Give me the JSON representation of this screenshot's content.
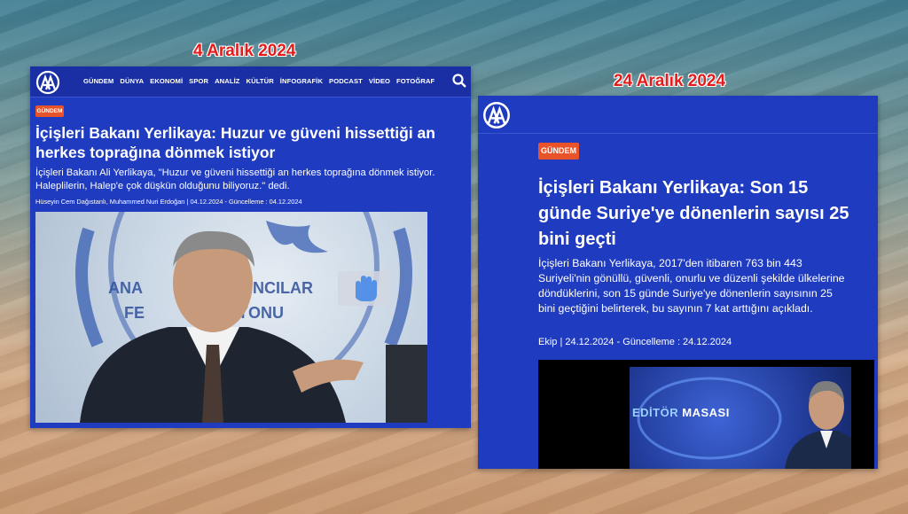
{
  "captions": {
    "left_date": "4 Aralık 2024",
    "right_date": "24 Aralık 2024"
  },
  "left_article": {
    "logo_text": "AA",
    "nav": [
      "GÜNDEM",
      "DÜNYA",
      "EKONOMİ",
      "SPOR",
      "ANALİZ",
      "KÜLTÜR",
      "İNFOGRAFİK",
      "PODCAST",
      "VİDEO",
      "FOTOĞRAF"
    ],
    "search_icon": "search-icon",
    "tag": "GÜNDEM",
    "title": "İçişleri Bakanı Yerlikaya: Huzur ve güveni hissettiği an herkes toprağına dönmek istiyor",
    "summary": "İçişleri Bakanı Ali Yerlikaya, \"Huzur ve güveni hissettiği an herkes toprağına dönmek istiyor. Haleplilerin, Halep'e çok düşkün olduğunu biliyoruz.\" dedi.",
    "byline": "Hüseyin Cem Dağıstanlı, Muhammed Nuri Erdoğan  |   04.12.2024 - Güncelleme : 04.12.2024",
    "photo_banner_text": "ANA  YINCILAR FE  YONU"
  },
  "right_article": {
    "logo_text": "AA",
    "tag": "GÜNDEM",
    "title": "İçişleri Bakanı Yerlikaya: Son 15 günde Suriye'ye dönenlerin sayısı 25 bini geçti",
    "summary": "İçişleri Bakanı Yerlikaya, 2017'den itibaren 763 bin 443 Suriyeli'nin gönüllü, güvenli, onurlu ve düzenli şekilde ülkelerine döndüklerini, son 15 günde Suriye'ye dönenlerin sayısının 25 bini geçtiğini belirterek, bu sayının 7 kat arttığını açıkladı.",
    "byline": "Ekip  |    24.12.2024 - Güncelleme : 24.12.2024",
    "video_label_a": "EDİTÖR",
    "video_label_b": "MASASI",
    "hand_icon": "hand-icon"
  },
  "colors": {
    "brand_blue": "#1f3bbf",
    "tag_orange": "#e8532a",
    "caption_red": "#e51b1b"
  }
}
